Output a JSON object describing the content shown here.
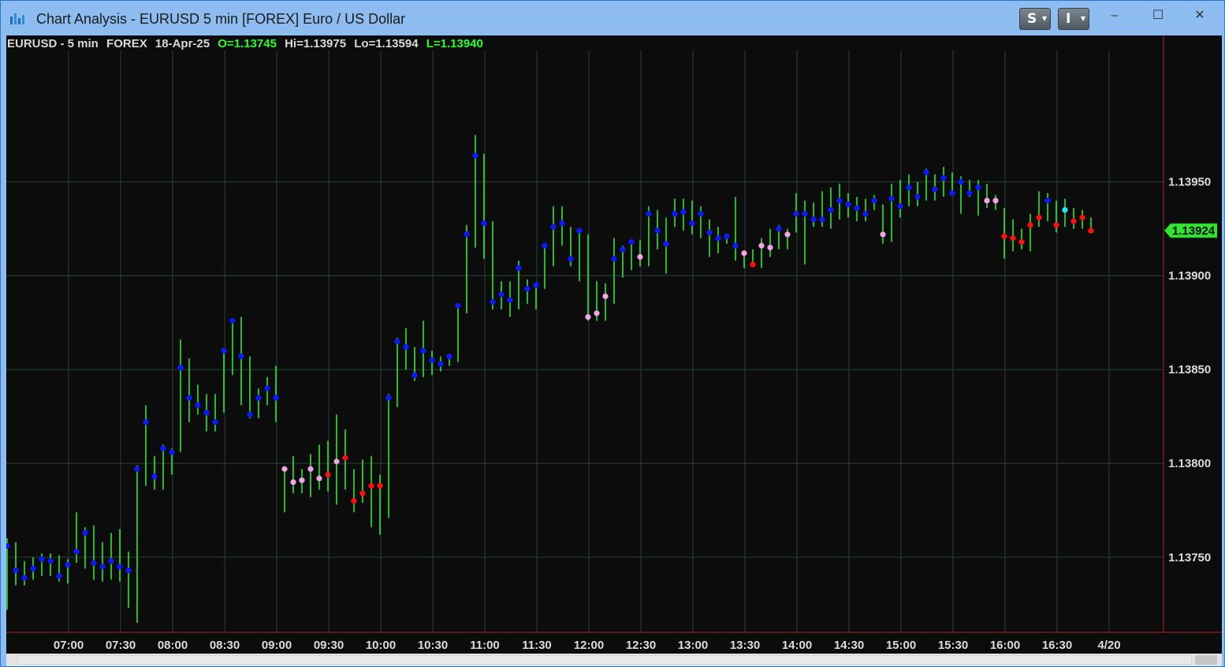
{
  "window": {
    "title": "Chart Analysis - EURUSD 5 min [FOREX] Euro / US Dollar",
    "buttons": [
      {
        "label": "S"
      },
      {
        "label": "I"
      }
    ],
    "controls": {
      "minimize": "–",
      "maximize": "☐",
      "close": "✕"
    }
  },
  "info": {
    "symbol": "EURUSD - 5 min",
    "exchange": "FOREX",
    "date": "18-Apr-25",
    "open": "O=1.13745",
    "high": "Hi=1.13975",
    "low": "Lo=1.13594",
    "last": "L=1.13940"
  },
  "colors": {
    "background": "#0c0c0c",
    "grid": "#27413a",
    "bar": "#2ee62e",
    "dot_blue": "#0a1cff",
    "dot_pink": "#f2a6e6",
    "dot_red": "#ff1010",
    "dot_cyan": "#27e6f2",
    "axis_text": "#dcdcdc",
    "border": "#b51e28",
    "price_marker": "#2ee62e"
  },
  "chart_data": {
    "type": "ohlc",
    "timeframe": "5 min",
    "start_time": "06:50",
    "ylim": [
      1.1371,
      1.1402
    ],
    "y_ticks": [
      "1.13750",
      "1.13800",
      "1.13850",
      "1.13900",
      "1.13950"
    ],
    "x_ticks": [
      "07:00",
      "07:30",
      "08:00",
      "08:30",
      "09:00",
      "09:30",
      "10:00",
      "10:30",
      "11:00",
      "11:30",
      "12:00",
      "12:30",
      "13:00",
      "13:30",
      "14:00",
      "14:30",
      "15:00",
      "15:30",
      "16:00",
      "16:30",
      "4/20"
    ],
    "last_price": "1.13924",
    "dot_legend_codes": {
      "b": "blue",
      "p": "pink",
      "r": "red",
      "c": "cyan"
    },
    "bars": [
      {
        "time": "06:50",
        "high": 1.1376,
        "low": 1.13722,
        "close": 1.13756,
        "dot": "b"
      },
      {
        "time": "06:55",
        "high": 1.13758,
        "low": 1.13735,
        "close": 1.13743,
        "dot": "b"
      },
      {
        "time": "07:00",
        "high": 1.13748,
        "low": 1.13735,
        "close": 1.13739,
        "dot": "b"
      },
      {
        "time": "07:05",
        "high": 1.1375,
        "low": 1.13738,
        "close": 1.13744,
        "dot": "b"
      },
      {
        "time": "07:10",
        "high": 1.13752,
        "low": 1.1374,
        "close": 1.13749,
        "dot": "b"
      },
      {
        "time": "07:15",
        "high": 1.13752,
        "low": 1.1374,
        "close": 1.13748,
        "dot": "b"
      },
      {
        "time": "07:20",
        "high": 1.13751,
        "low": 1.13737,
        "close": 1.1374,
        "dot": "b"
      },
      {
        "time": "07:25",
        "high": 1.13749,
        "low": 1.13736,
        "close": 1.13746,
        "dot": "b"
      },
      {
        "time": "07:30",
        "high": 1.13774,
        "low": 1.13747,
        "close": 1.13753,
        "dot": "b"
      },
      {
        "time": "07:35",
        "high": 1.13766,
        "low": 1.13744,
        "close": 1.13763,
        "dot": "b"
      },
      {
        "time": "07:40",
        "high": 1.13767,
        "low": 1.13738,
        "close": 1.13747,
        "dot": "b"
      },
      {
        "time": "07:45",
        "high": 1.13758,
        "low": 1.13737,
        "close": 1.13745,
        "dot": "b"
      },
      {
        "time": "07:50",
        "high": 1.13763,
        "low": 1.13738,
        "close": 1.13748,
        "dot": "b"
      },
      {
        "time": "07:55",
        "high": 1.13765,
        "low": 1.13737,
        "close": 1.13745,
        "dot": "b"
      },
      {
        "time": "08:00",
        "high": 1.13753,
        "low": 1.13723,
        "close": 1.13743,
        "dot": "b"
      },
      {
        "time": "08:05",
        "high": 1.13799,
        "low": 1.13715,
        "close": 1.13797,
        "dot": "b"
      },
      {
        "time": "08:10",
        "high": 1.13831,
        "low": 1.13788,
        "close": 1.13822,
        "dot": "b"
      },
      {
        "time": "08:15",
        "high": 1.13804,
        "low": 1.13786,
        "close": 1.13793,
        "dot": "b"
      },
      {
        "time": "08:20",
        "high": 1.1381,
        "low": 1.13786,
        "close": 1.13808,
        "dot": "b"
      },
      {
        "time": "08:25",
        "high": 1.13808,
        "low": 1.13794,
        "close": 1.13806,
        "dot": "b"
      },
      {
        "time": "08:30",
        "high": 1.13866,
        "low": 1.13806,
        "close": 1.13851,
        "dot": "b"
      },
      {
        "time": "08:35",
        "high": 1.13856,
        "low": 1.13822,
        "close": 1.13835,
        "dot": "b"
      },
      {
        "time": "08:40",
        "high": 1.13842,
        "low": 1.13826,
        "close": 1.13831,
        "dot": "b"
      },
      {
        "time": "08:45",
        "high": 1.13837,
        "low": 1.13817,
        "close": 1.13827,
        "dot": "b"
      },
      {
        "time": "08:50",
        "high": 1.13837,
        "low": 1.13817,
        "close": 1.13822,
        "dot": "b"
      },
      {
        "time": "08:55",
        "high": 1.13861,
        "low": 1.13827,
        "close": 1.1386,
        "dot": "b"
      },
      {
        "time": "09:00",
        "high": 1.13877,
        "low": 1.13847,
        "close": 1.13876,
        "dot": "b"
      },
      {
        "time": "09:05",
        "high": 1.13878,
        "low": 1.13831,
        "close": 1.13857,
        "dot": "b"
      },
      {
        "time": "09:10",
        "high": 1.13857,
        "low": 1.13824,
        "close": 1.13826,
        "dot": "b"
      },
      {
        "time": "09:15",
        "high": 1.1384,
        "low": 1.13824,
        "close": 1.13835,
        "dot": "b"
      },
      {
        "time": "09:20",
        "high": 1.13846,
        "low": 1.13831,
        "close": 1.1384,
        "dot": "b"
      },
      {
        "time": "09:25",
        "high": 1.13852,
        "low": 1.13822,
        "close": 1.13835,
        "dot": "b"
      },
      {
        "time": "09:30",
        "high": 1.13797,
        "low": 1.13774,
        "close": 1.13797,
        "dot": "p"
      },
      {
        "time": "09:35",
        "high": 1.13804,
        "low": 1.13784,
        "close": 1.1379,
        "dot": "p"
      },
      {
        "time": "09:40",
        "high": 1.13797,
        "low": 1.13784,
        "close": 1.13791,
        "dot": "p"
      },
      {
        "time": "09:45",
        "high": 1.13805,
        "low": 1.13782,
        "close": 1.13797,
        "dot": "p"
      },
      {
        "time": "09:50",
        "high": 1.1381,
        "low": 1.13786,
        "close": 1.13792,
        "dot": "p"
      },
      {
        "time": "09:55",
        "high": 1.13812,
        "low": 1.13785,
        "close": 1.13794,
        "dot": "r"
      },
      {
        "time": "10:00",
        "high": 1.13826,
        "low": 1.13778,
        "close": 1.13801,
        "dot": "p"
      },
      {
        "time": "10:05",
        "high": 1.13818,
        "low": 1.13786,
        "close": 1.13803,
        "dot": "r"
      },
      {
        "time": "10:10",
        "high": 1.13797,
        "low": 1.13774,
        "close": 1.1378,
        "dot": "r"
      },
      {
        "time": "10:15",
        "high": 1.13802,
        "low": 1.13779,
        "close": 1.13784,
        "dot": "r"
      },
      {
        "time": "10:20",
        "high": 1.13804,
        "low": 1.13766,
        "close": 1.13788,
        "dot": "r"
      },
      {
        "time": "10:25",
        "high": 1.13794,
        "low": 1.13762,
        "close": 1.13788,
        "dot": "r"
      },
      {
        "time": "10:30",
        "high": 1.13837,
        "low": 1.13771,
        "close": 1.13835,
        "dot": "b"
      },
      {
        "time": "10:35",
        "high": 1.13867,
        "low": 1.1383,
        "close": 1.13865,
        "dot": "b"
      },
      {
        "time": "10:40",
        "high": 1.13872,
        "low": 1.1385,
        "close": 1.13862,
        "dot": "b"
      },
      {
        "time": "10:45",
        "high": 1.13862,
        "low": 1.13844,
        "close": 1.13847,
        "dot": "b"
      },
      {
        "time": "10:50",
        "high": 1.13876,
        "low": 1.13846,
        "close": 1.1386,
        "dot": "b"
      },
      {
        "time": "10:55",
        "high": 1.1386,
        "low": 1.13847,
        "close": 1.13855,
        "dot": "b"
      },
      {
        "time": "11:00",
        "high": 1.13857,
        "low": 1.13849,
        "close": 1.13853,
        "dot": "b"
      },
      {
        "time": "11:05",
        "high": 1.13858,
        "low": 1.13852,
        "close": 1.13857,
        "dot": "b"
      },
      {
        "time": "11:10",
        "high": 1.13885,
        "low": 1.13854,
        "close": 1.13884,
        "dot": "b"
      },
      {
        "time": "11:15",
        "high": 1.13927,
        "low": 1.1388,
        "close": 1.13922,
        "dot": "b"
      },
      {
        "time": "11:20",
        "high": 1.13975,
        "low": 1.13915,
        "close": 1.13964,
        "dot": "b"
      },
      {
        "time": "11:25",
        "high": 1.13965,
        "low": 1.13909,
        "close": 1.13928,
        "dot": "b"
      },
      {
        "time": "11:30",
        "high": 1.13929,
        "low": 1.13882,
        "close": 1.13886,
        "dot": "b"
      },
      {
        "time": "11:35",
        "high": 1.13897,
        "low": 1.13882,
        "close": 1.1389,
        "dot": "b"
      },
      {
        "time": "11:40",
        "high": 1.13897,
        "low": 1.13878,
        "close": 1.13887,
        "dot": "b"
      },
      {
        "time": "11:45",
        "high": 1.13908,
        "low": 1.13882,
        "close": 1.13904,
        "dot": "b"
      },
      {
        "time": "11:50",
        "high": 1.13898,
        "low": 1.13885,
        "close": 1.13893,
        "dot": "b"
      },
      {
        "time": "11:55",
        "high": 1.13895,
        "low": 1.13882,
        "close": 1.13895,
        "dot": "b"
      },
      {
        "time": "12:00",
        "high": 1.13917,
        "low": 1.13893,
        "close": 1.13916,
        "dot": "b"
      },
      {
        "time": "12:05",
        "high": 1.13937,
        "low": 1.13905,
        "close": 1.13926,
        "dot": "b"
      },
      {
        "time": "12:10",
        "high": 1.13937,
        "low": 1.13916,
        "close": 1.13928,
        "dot": "b"
      },
      {
        "time": "12:15",
        "high": 1.13926,
        "low": 1.13905,
        "close": 1.13909,
        "dot": "b"
      },
      {
        "time": "12:20",
        "high": 1.13925,
        "low": 1.13897,
        "close": 1.13924,
        "dot": "b"
      },
      {
        "time": "12:25",
        "high": 1.13922,
        "low": 1.13876,
        "close": 1.13878,
        "dot": "p"
      },
      {
        "time": "12:30",
        "high": 1.13897,
        "low": 1.13876,
        "close": 1.1388,
        "dot": "p"
      },
      {
        "time": "12:35",
        "high": 1.13896,
        "low": 1.13876,
        "close": 1.13889,
        "dot": "p"
      },
      {
        "time": "12:40",
        "high": 1.1392,
        "low": 1.13885,
        "close": 1.13909,
        "dot": "b"
      },
      {
        "time": "12:45",
        "high": 1.13916,
        "low": 1.13899,
        "close": 1.13914,
        "dot": "b"
      },
      {
        "time": "12:50",
        "high": 1.13919,
        "low": 1.13903,
        "close": 1.13918,
        "dot": "b"
      },
      {
        "time": "12:55",
        "high": 1.13919,
        "low": 1.13905,
        "close": 1.1391,
        "dot": "p"
      },
      {
        "time": "13:00",
        "high": 1.13937,
        "low": 1.13905,
        "close": 1.13933,
        "dot": "b"
      },
      {
        "time": "13:05",
        "high": 1.13935,
        "low": 1.13914,
        "close": 1.13924,
        "dot": "b"
      },
      {
        "time": "13:10",
        "high": 1.13931,
        "low": 1.13901,
        "close": 1.13917,
        "dot": "b"
      },
      {
        "time": "13:15",
        "high": 1.13941,
        "low": 1.13926,
        "close": 1.13933,
        "dot": "b"
      },
      {
        "time": "13:20",
        "high": 1.13941,
        "low": 1.13924,
        "close": 1.13934,
        "dot": "b"
      },
      {
        "time": "13:25",
        "high": 1.1394,
        "low": 1.13922,
        "close": 1.13928,
        "dot": "b"
      },
      {
        "time": "13:30",
        "high": 1.13937,
        "low": 1.1392,
        "close": 1.13933,
        "dot": "b"
      },
      {
        "time": "13:35",
        "high": 1.1393,
        "low": 1.1391,
        "close": 1.13923,
        "dot": "b"
      },
      {
        "time": "13:40",
        "high": 1.13926,
        "low": 1.13912,
        "close": 1.1392,
        "dot": "b"
      },
      {
        "time": "13:45",
        "high": 1.13922,
        "low": 1.13917,
        "close": 1.13921,
        "dot": "b"
      },
      {
        "time": "13:50",
        "high": 1.13942,
        "low": 1.13908,
        "close": 1.13916,
        "dot": "b"
      },
      {
        "time": "13:55",
        "high": 1.13913,
        "low": 1.13904,
        "close": 1.13912,
        "dot": "p"
      },
      {
        "time": "14:00",
        "high": 1.13914,
        "low": 1.13905,
        "close": 1.13906,
        "dot": "r"
      },
      {
        "time": "14:05",
        "high": 1.1392,
        "low": 1.13904,
        "close": 1.13916,
        "dot": "p"
      },
      {
        "time": "14:10",
        "high": 1.13925,
        "low": 1.1391,
        "close": 1.13915,
        "dot": "p"
      },
      {
        "time": "14:15",
        "high": 1.13927,
        "low": 1.13914,
        "close": 1.13925,
        "dot": "b"
      },
      {
        "time": "14:20",
        "high": 1.13925,
        "low": 1.13914,
        "close": 1.13922,
        "dot": "p"
      },
      {
        "time": "14:25",
        "high": 1.13944,
        "low": 1.13923,
        "close": 1.13933,
        "dot": "b"
      },
      {
        "time": "14:30",
        "high": 1.1394,
        "low": 1.13906,
        "close": 1.13933,
        "dot": "b"
      },
      {
        "time": "14:35",
        "high": 1.13939,
        "low": 1.13926,
        "close": 1.1393,
        "dot": "b"
      },
      {
        "time": "14:40",
        "high": 1.13945,
        "low": 1.13926,
        "close": 1.1393,
        "dot": "b"
      },
      {
        "time": "14:45",
        "high": 1.13947,
        "low": 1.13925,
        "close": 1.13935,
        "dot": "b"
      },
      {
        "time": "14:50",
        "high": 1.13949,
        "low": 1.1393,
        "close": 1.1394,
        "dot": "b"
      },
      {
        "time": "14:55",
        "high": 1.13944,
        "low": 1.13931,
        "close": 1.13938,
        "dot": "b"
      },
      {
        "time": "15:00",
        "high": 1.13942,
        "low": 1.13929,
        "close": 1.13936,
        "dot": "b"
      },
      {
        "time": "15:05",
        "high": 1.13941,
        "low": 1.13929,
        "close": 1.13933,
        "dot": "b"
      },
      {
        "time": "15:10",
        "high": 1.13943,
        "low": 1.13935,
        "close": 1.1394,
        "dot": "b"
      },
      {
        "time": "15:15",
        "high": 1.13938,
        "low": 1.13917,
        "close": 1.13922,
        "dot": "p"
      },
      {
        "time": "15:20",
        "high": 1.13949,
        "low": 1.13918,
        "close": 1.13941,
        "dot": "b"
      },
      {
        "time": "15:25",
        "high": 1.13951,
        "low": 1.13931,
        "close": 1.13937,
        "dot": "b"
      },
      {
        "time": "15:30",
        "high": 1.13954,
        "low": 1.13937,
        "close": 1.13947,
        "dot": "b"
      },
      {
        "time": "15:35",
        "high": 1.1395,
        "low": 1.13937,
        "close": 1.13942,
        "dot": "b"
      },
      {
        "time": "15:40",
        "high": 1.13957,
        "low": 1.1394,
        "close": 1.13955,
        "dot": "b"
      },
      {
        "time": "15:45",
        "high": 1.13954,
        "low": 1.1394,
        "close": 1.13946,
        "dot": "b"
      },
      {
        "time": "15:50",
        "high": 1.13958,
        "low": 1.13942,
        "close": 1.13952,
        "dot": "b"
      },
      {
        "time": "15:55",
        "high": 1.13955,
        "low": 1.13943,
        "close": 1.13944,
        "dot": "b"
      },
      {
        "time": "16:00",
        "high": 1.13953,
        "low": 1.13933,
        "close": 1.1395,
        "dot": "b"
      },
      {
        "time": "16:05",
        "high": 1.13951,
        "low": 1.13942,
        "close": 1.13944,
        "dot": "b"
      },
      {
        "time": "16:10",
        "high": 1.13951,
        "low": 1.13932,
        "close": 1.13947,
        "dot": "b"
      },
      {
        "time": "16:15",
        "high": 1.13949,
        "low": 1.13936,
        "close": 1.1394,
        "dot": "p"
      },
      {
        "time": "16:20",
        "high": 1.13943,
        "low": 1.13935,
        "close": 1.1394,
        "dot": "p"
      },
      {
        "time": "16:25",
        "high": 1.13936,
        "low": 1.13909,
        "close": 1.13921,
        "dot": "r"
      },
      {
        "time": "16:30",
        "high": 1.1393,
        "low": 1.13913,
        "close": 1.1392,
        "dot": "r"
      },
      {
        "time": "16:35",
        "high": 1.13925,
        "low": 1.13914,
        "close": 1.13918,
        "dot": "r"
      },
      {
        "time": "16:40",
        "high": 1.13933,
        "low": 1.13913,
        "close": 1.13927,
        "dot": "r"
      },
      {
        "time": "16:45",
        "high": 1.13945,
        "low": 1.13926,
        "close": 1.13931,
        "dot": "r"
      },
      {
        "time": "16:50",
        "high": 1.13944,
        "low": 1.13929,
        "close": 1.1394,
        "dot": "b"
      },
      {
        "time": "16:55",
        "high": 1.1394,
        "low": 1.13923,
        "close": 1.13927,
        "dot": "r"
      },
      {
        "time": "17:00",
        "high": 1.13941,
        "low": 1.13926,
        "close": 1.13935,
        "dot": "c"
      },
      {
        "time": "17:05",
        "high": 1.13936,
        "low": 1.13925,
        "close": 1.13929,
        "dot": "r"
      },
      {
        "time": "17:10",
        "high": 1.13935,
        "low": 1.13925,
        "close": 1.13931,
        "dot": "r"
      },
      {
        "time": "17:15",
        "high": 1.13931,
        "low": 1.13924,
        "close": 1.13924,
        "dot": "r"
      }
    ]
  }
}
